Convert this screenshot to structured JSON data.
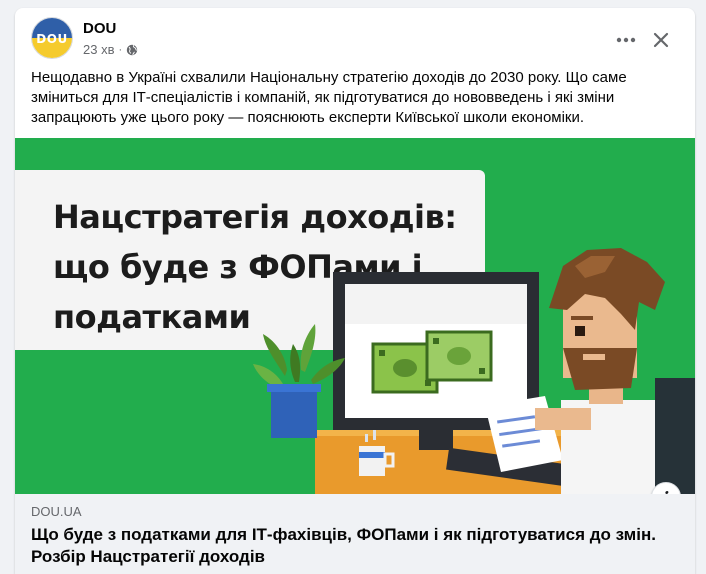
{
  "post": {
    "author": "DOU",
    "avatar_text": "DOU",
    "time": "23 хв",
    "separator": "·",
    "privacy_icon": "globe-icon",
    "body": "Нещодавно в Україні схвалили Національну стратегію доходів до 2030 року. Що саме зміниться для ІТ-спеціалістів і компаній, як підготуватися до нововведень і які зміни запрацюють уже цього року — пояснюють експерти Київської школи економіки."
  },
  "actions": {
    "more_icon": "more-horizontal-icon",
    "close_icon": "close-icon"
  },
  "image": {
    "headline_line1": "Нацстратегія доходів:",
    "headline_line2": "що буде з ФОПами і",
    "headline_line3": "податками",
    "info_label": "i"
  },
  "link": {
    "domain": "DOU.UA",
    "title": "Що буде з податками для ІТ-фахівців, ФОПами і як підготуватися до змін. Розбір Нацстратегії доходів"
  },
  "colors": {
    "image_background": "#22ad4d",
    "avatar_blue": "#2f5fa8",
    "avatar_yellow": "#f5cb2d",
    "secondary_text": "#65676b"
  }
}
